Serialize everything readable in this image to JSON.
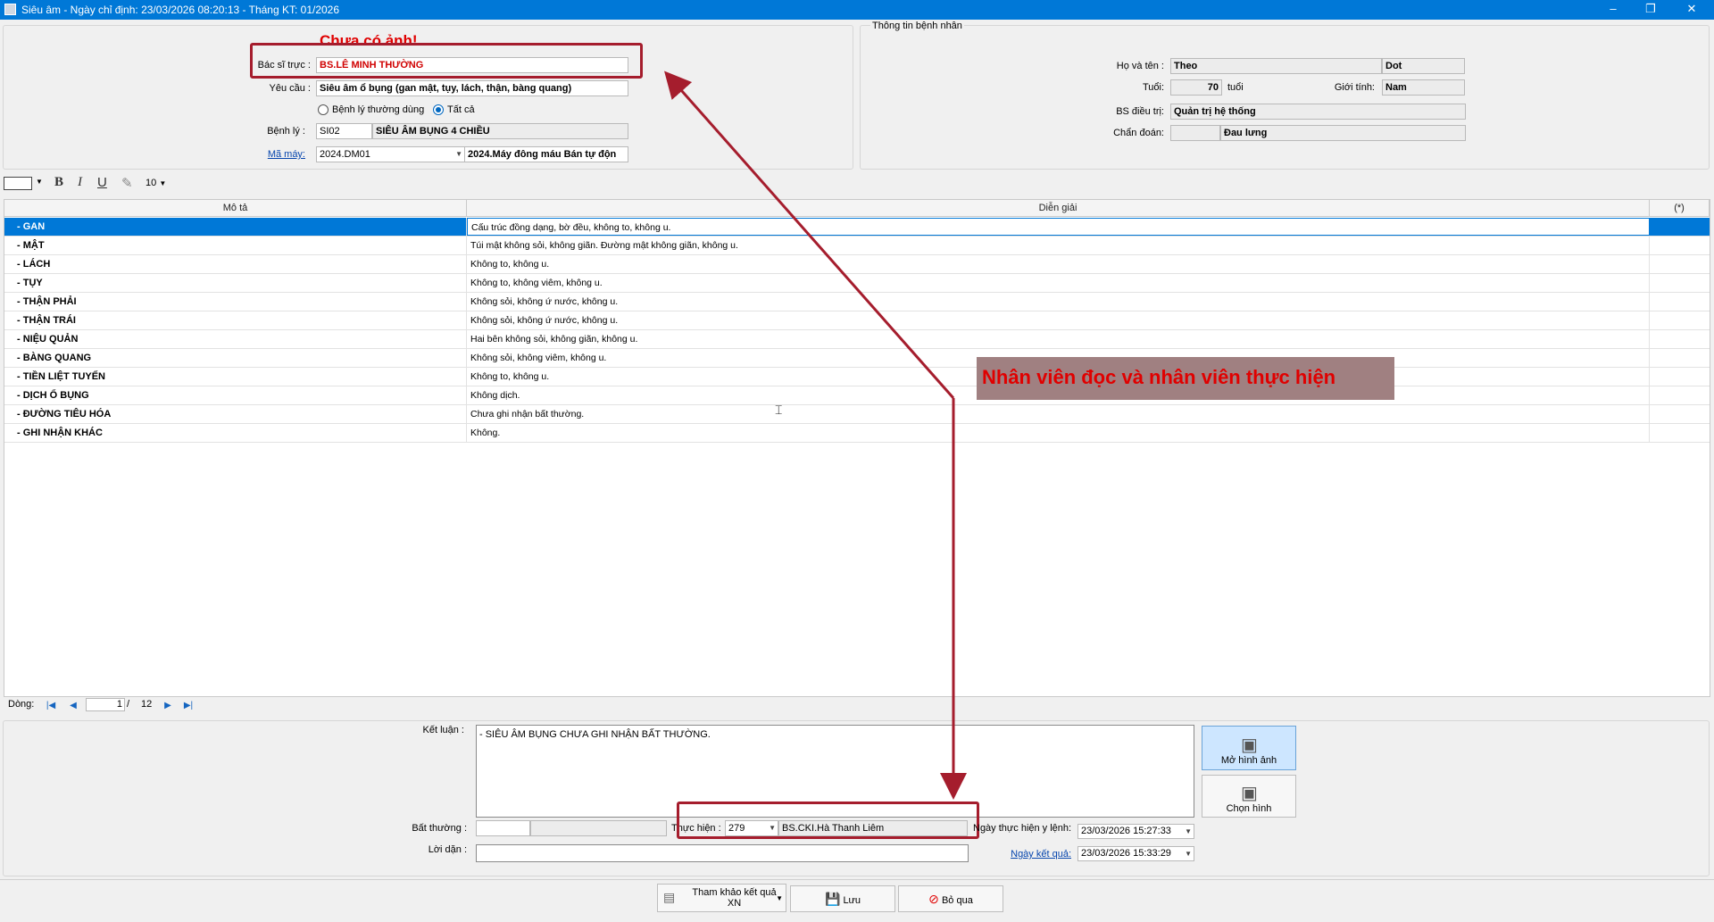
{
  "window": {
    "title": "Siêu âm - Ngày chỉ định: 23/03/2026 08:20:13 - Tháng KT: 01/2026",
    "min_glyph": "–",
    "max_glyph": "❐",
    "close_glyph": "✕"
  },
  "header": {
    "no_image_text": "Chưa có ảnh!",
    "doctor_label": "Bác sĩ trực :",
    "doctor_value": "BS.LÊ MINH THƯỜNG",
    "request_label": "Yêu cầu :",
    "request_value": "Siêu âm ổ bụng (gan mật, tụy, lách, thận, bàng quang)",
    "radio_common": "Bệnh lý thường dùng",
    "radio_all": "Tất cả",
    "disease_label": "Bệnh lý :",
    "disease_code": "SI02",
    "disease_name": "SIÊU ÂM BỤNG 4 CHIỀU",
    "machine_label": "Mã máy:",
    "machine_code": "2024.DM01",
    "machine_name": "2024.Máy đông máu Bán tự độn"
  },
  "patient": {
    "group_title": "Thông tin bệnh nhân",
    "name_label": "Họ và tên :",
    "name_first": "Theo",
    "name_last": "Dot",
    "age_label": "Tuổi:",
    "age_value": "70",
    "age_unit": "tuổi",
    "sex_label": "Giới tính:",
    "sex_value": "Nam",
    "doctor_label": "BS điều trị:",
    "doctor_value": "Quản trị hệ thống",
    "diagnosis_label": "Chẩn đoán:",
    "diagnosis_value": "Đau lưng"
  },
  "toolbar": {
    "bold": "B",
    "italic": "I",
    "underline": "U",
    "font_size": "10"
  },
  "grid": {
    "headers": [
      "Mô tả",
      "Diễn giải",
      "(*)"
    ],
    "rows": [
      {
        "name": "- GAN",
        "desc": "Cấu trúc đồng dạng, bờ đều, không to, không u."
      },
      {
        "name": "- MẬT",
        "desc": "Túi mật không sỏi, không giãn. Đường mật không giãn, không u."
      },
      {
        "name": "- LÁCH",
        "desc": "Không to, không u."
      },
      {
        "name": "- TỤY",
        "desc": "Không to, không viêm, không u."
      },
      {
        "name": "- THẬN PHẢI",
        "desc": "Không sỏi, không ứ nước, không u."
      },
      {
        "name": "- THẬN TRÁI",
        "desc": "Không sỏi, không ứ nước, không u."
      },
      {
        "name": "- NIỆU QUẢN",
        "desc": "Hai bên không sỏi, không giãn, không u."
      },
      {
        "name": "- BÀNG QUANG",
        "desc": "Không sỏi, không viêm, không u."
      },
      {
        "name": "- TIỀN LIỆT TUYẾN",
        "desc": "Không to, không u."
      },
      {
        "name": "- DỊCH Ổ BỤNG",
        "desc": "Không dịch."
      },
      {
        "name": "- ĐƯỜNG TIÊU HÓA",
        "desc": "Chưa ghi nhận bất thường."
      },
      {
        "name": "- GHI NHẬN KHÁC",
        "desc": "Không."
      }
    ],
    "selected_index": 0
  },
  "pager": {
    "label": "Dòng:",
    "current": "1",
    "separator": "/",
    "total": "12"
  },
  "result": {
    "conclusion_label": "Kết luận :",
    "conclusion_text": "- SIÊU ÂM BỤNG CHƯA GHI NHẬN BẤT THƯỜNG.",
    "abnormal_label": "Bất thường :",
    "performer_label": "Thực hiện :",
    "performer_code": "279",
    "performer_name": "BS.CKI.Hà Thanh Liêm",
    "note_label": "Lời dặn :",
    "exec_date_label": "Ngày thực hiện y lệnh:",
    "exec_date_value": "23/03/2026  15:27:33",
    "result_date_label": "Ngày kết quả:",
    "result_date_value": "23/03/2026  15:33:29",
    "open_image_btn": "Mở hình ảnh",
    "choose_image_btn": "Chọn hình"
  },
  "footer": {
    "reference_btn_line1": "Tham khảo kết quả",
    "reference_btn_line2": "XN",
    "save_btn": "Lưu",
    "cancel_btn": "Bỏ qua"
  },
  "annotation": {
    "text": "Nhân viên đọc và nhân viên thực hiện"
  },
  "colors": {
    "titlebar": "#0078d7",
    "selection": "#0078d7",
    "annotation_red": "#e00000",
    "box_red": "#a51d2d"
  }
}
